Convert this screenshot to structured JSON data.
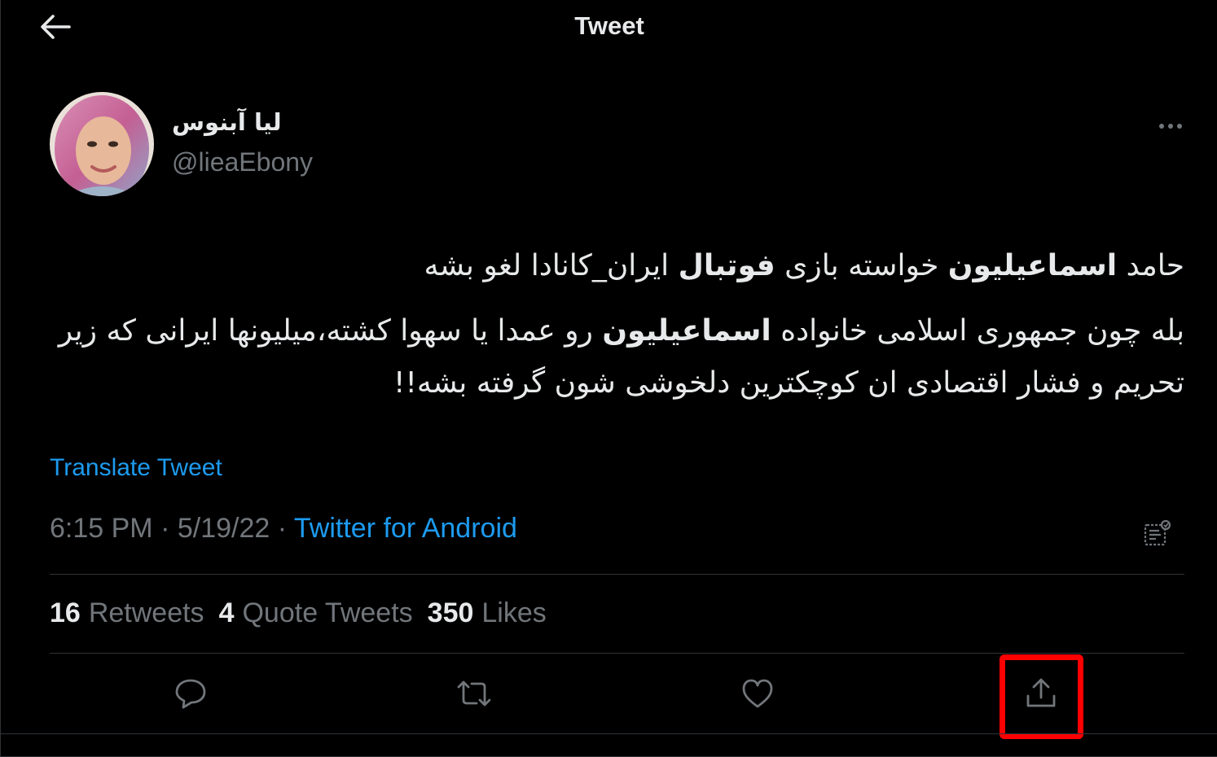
{
  "header": {
    "back_icon": "arrow-left-icon",
    "title": "Tweet"
  },
  "author": {
    "display_name": "لیا آبنوس",
    "handle": "@lieaEbony"
  },
  "tweet": {
    "line1": {
      "p1": "حامد ",
      "b1": "اسماعیلیون",
      "p2": " خواسته بازی ",
      "b2": "فوتبال",
      "p3": " ایران_کانادا لغو بشه"
    },
    "line2": {
      "p1": "بله چون جمهوری اسلامی خانواده ",
      "b1": "اسماعیلیون",
      "p2": " رو عمدا یا سهوا کشته،میلیونها ایرانی که زیر تحریم و فشار اقتصادی ان کوچکترین دلخوشی شون گرفته بشه!!"
    },
    "translate_label": "Translate Tweet",
    "time": "6:15 PM",
    "separator": " · ",
    "date": "5/19/22",
    "source": "Twitter for Android"
  },
  "stats": {
    "retweets_count": "16",
    "retweets_label": "Retweets",
    "quotes_count": "4",
    "quotes_label": "Quote Tweets",
    "likes_count": "350",
    "likes_label": "Likes"
  },
  "colors": {
    "background": "#000000",
    "text": "#e7e9ea",
    "secondary": "#71767b",
    "accent": "#1d9bf0",
    "divider": "#2f3336",
    "highlight": "#ff0000"
  },
  "icons": [
    "arrow-left-icon",
    "more-icon",
    "analytics-icon",
    "reply-icon",
    "retweet-icon",
    "like-icon",
    "share-icon"
  ]
}
